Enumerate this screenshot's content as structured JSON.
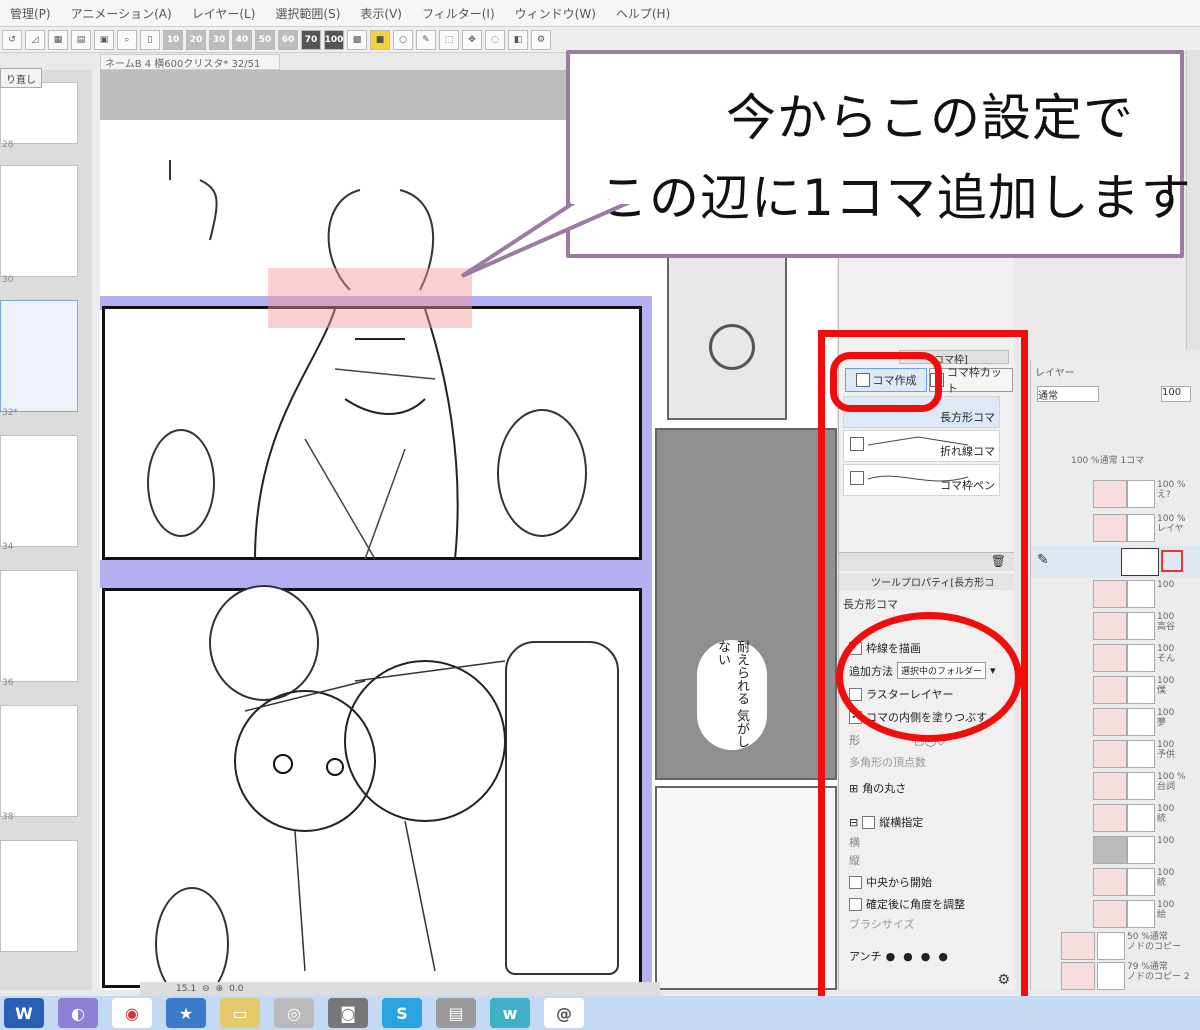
{
  "menu": [
    "管理(P)",
    "アニメーション(A)",
    "レイヤー(L)",
    "選択範囲(S)",
    "表示(V)",
    "フィルター(I)",
    "ウィンドウ(W)",
    "ヘルプ(H)"
  ],
  "toolbar": {
    "zoom_numbers": [
      "10",
      "20",
      "30",
      "40",
      "50",
      "60",
      "70",
      "100"
    ]
  },
  "document_tab": "ネームB 4 横600クリスタ* 32/51",
  "undo_label": "り直し",
  "page_numbers": [
    "28",
    "30",
    "32*",
    "34",
    "36",
    "38"
  ],
  "callout": {
    "line1": "今からこの設定で",
    "line2": "この辺に1コマ追加します"
  },
  "comic_text": "耐えられる 気がしない",
  "tool_panel": {
    "tab_label": "コマ枠]",
    "buttons": [
      "コマ作成",
      "コマ枠カット"
    ],
    "sub_tools": [
      "長方形コマ",
      "折れ線コマ",
      "コマ枠ペン"
    ],
    "property_header": "ツールプロパティ[長方形コ",
    "property_title": "長方形コマ",
    "draw_border_label": "枠線を描画",
    "add_method_label": "追加方法",
    "add_method_value": "選択中のフォルダー",
    "raster_layer_label": "ラスターレイヤー",
    "fill_inside_label": "コマの内側を塗りつぶす",
    "shape_label": "形",
    "polygon_label": "多角形の頂点数",
    "corner_round_label": "角の丸さ",
    "aspect_label": "縦横指定",
    "width_label": "横",
    "height_label": "縦",
    "from_center_label": "中央から開始",
    "adjust_angle_label": "確定後に角度を調整",
    "brush_size_label": "ブラシサイズ",
    "antialias_label": "アンチ"
  },
  "layer_panel": {
    "title": "レイヤー",
    "blend_mode": "通常",
    "opacity": "100",
    "folder_label": "100 %通常 1コマ",
    "rows": [
      {
        "top": "100 %",
        "bottom": "え?"
      },
      {
        "top": "100 %",
        "bottom": "レイヤ"
      },
      {
        "top": "100",
        "bottom": ""
      },
      {
        "top": "100",
        "bottom": "高谷"
      },
      {
        "top": "100",
        "bottom": "そん"
      },
      {
        "top": "100",
        "bottom": "僕"
      },
      {
        "top": "100",
        "bottom": "夢"
      },
      {
        "top": "100",
        "bottom": "予供"
      },
      {
        "top": "100 %",
        "bottom": "台詞"
      },
      {
        "top": "100",
        "bottom": "統"
      },
      {
        "top": "100",
        "bottom": ""
      },
      {
        "top": "100",
        "bottom": "統"
      },
      {
        "top": "100",
        "bottom": "絵"
      },
      {
        "top": "50 %通常",
        "bottom": "ノドのコピー"
      },
      {
        "top": "79 %通常",
        "bottom": "ノドのコピー 2"
      }
    ]
  },
  "status": {
    "zoom": "15.1",
    "angle": "0.0"
  },
  "colors": {
    "annotation_red": "#f20d0d",
    "callout_border": "#9a7ba2",
    "panel_gap": "#b4b0f2"
  }
}
